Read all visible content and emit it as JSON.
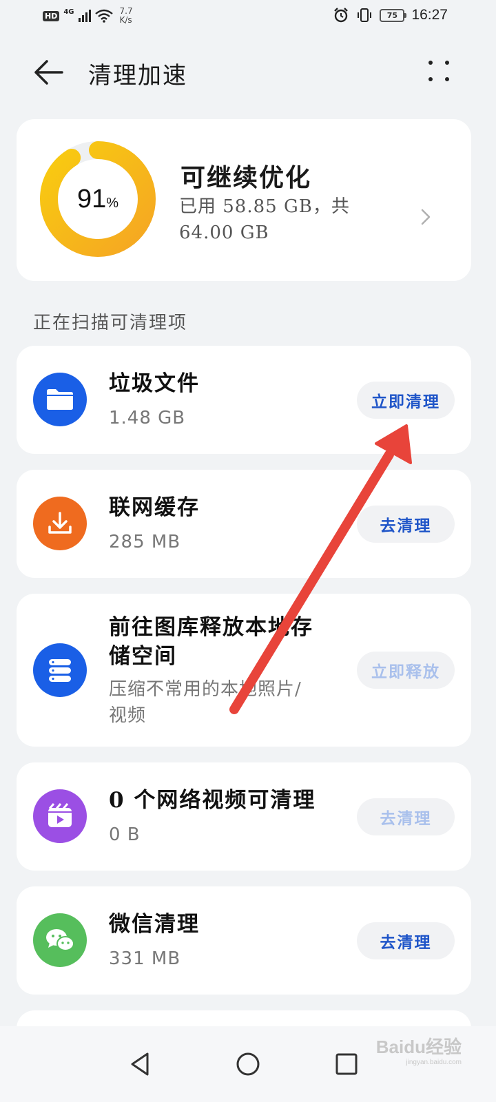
{
  "status_bar": {
    "hd": "HD",
    "network": "4G",
    "speed_value": "7.7",
    "speed_unit": "K/s",
    "battery": "75",
    "time": "16:27"
  },
  "header": {
    "title": "清理加速",
    "back_icon": "arrow-left-icon",
    "more_icon": "more-dots-icon"
  },
  "storage": {
    "percent_number": "91",
    "percent_unit": "%",
    "percent_value": 0.91,
    "status": "可继续优化",
    "detail_line1": "已用 58.85 GB，共",
    "detail_line2": "64.00 GB",
    "ring_colors": [
      "#f5a623",
      "#f8cc10"
    ]
  },
  "section_label": "正在扫描可清理项",
  "items": [
    {
      "name": "垃圾文件",
      "size": "1.48 GB",
      "button": "立即清理",
      "button_enabled": true,
      "icon": "folder-icon",
      "icon_color": "#1a5fe6"
    },
    {
      "name": "联网缓存",
      "size": "285 MB",
      "button": "去清理",
      "button_enabled": true,
      "icon": "download-icon",
      "icon_color": "#ef6b1f"
    },
    {
      "name_line1": "前往图库释放本地存",
      "name_line2": "储空间",
      "desc_line1": "压缩不常用的本地照片/",
      "desc_line2": "视频",
      "button": "立即释放",
      "button_enabled": false,
      "icon": "storage-stack-icon",
      "icon_color": "#1a5fe6"
    },
    {
      "name": "0 个网络视频可清理",
      "size": "0 B",
      "button": "去清理",
      "button_enabled": false,
      "icon": "video-clapper-icon",
      "icon_color": "#9b4fe4"
    },
    {
      "name": "微信清理",
      "size": "331 MB",
      "button": "去清理",
      "button_enabled": true,
      "icon": "wechat-icon",
      "icon_color": "#56be5c"
    }
  ],
  "annotation": {
    "color": "#e8443a"
  },
  "watermark": {
    "brand": "Baidu经验",
    "sub": "jingyan.baidu.com"
  },
  "navbar": {
    "back_icon": "nav-back-icon",
    "home_icon": "nav-home-icon",
    "recents_icon": "nav-recents-icon"
  }
}
